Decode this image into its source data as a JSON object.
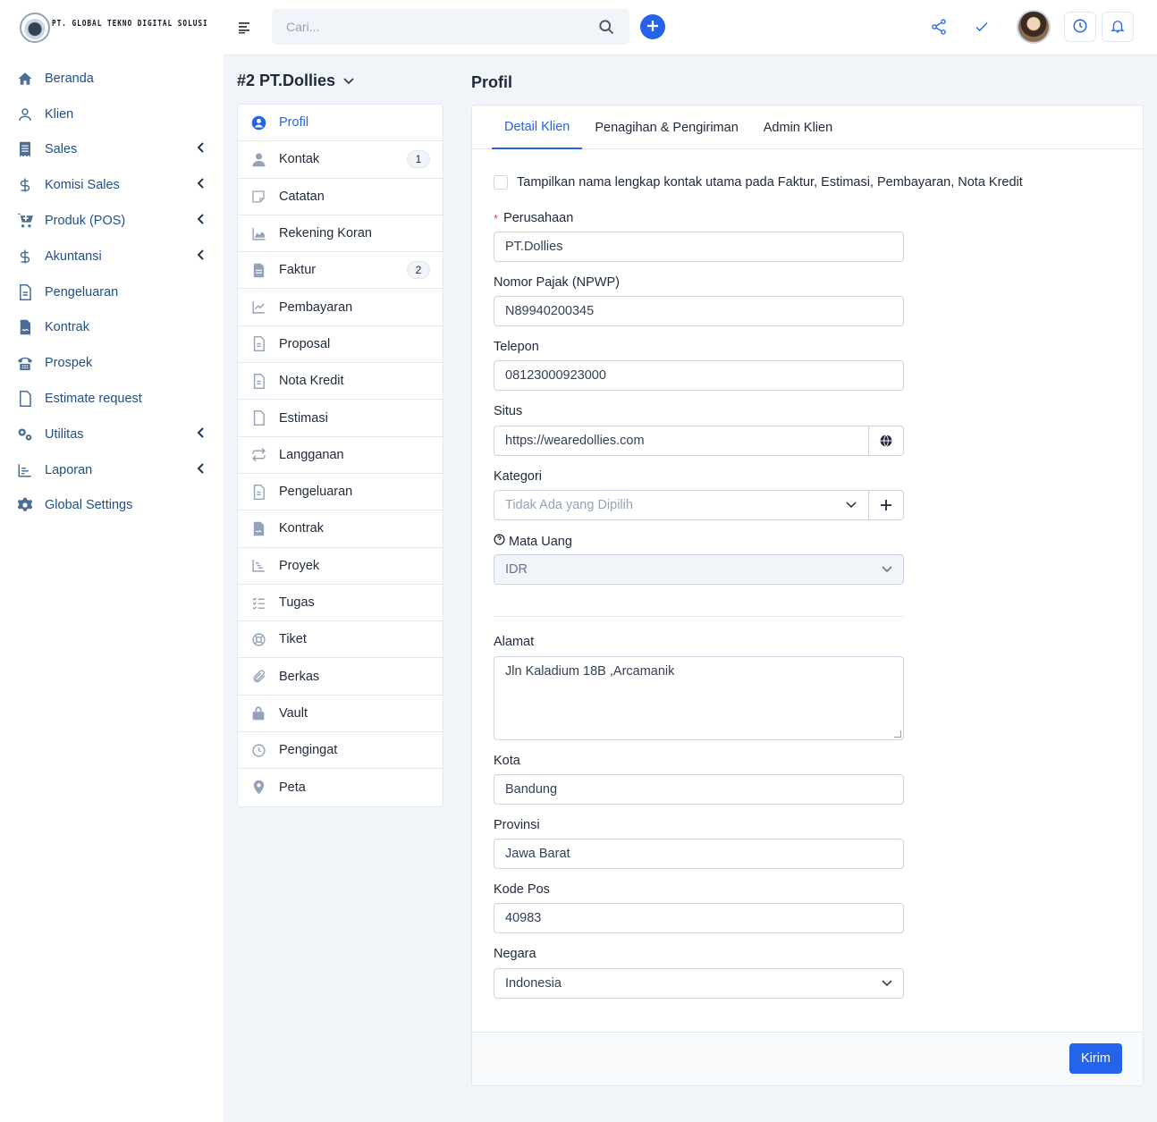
{
  "app": {
    "company_name": "PT. GLOBAL TEKNO DIGITAL SOLUSI"
  },
  "topbar": {
    "search_placeholder": "Cari...",
    "icons": [
      "menu-icon",
      "search-icon",
      "plus-icon",
      "share-icon",
      "check-icon",
      "clock-icon",
      "bell-icon"
    ]
  },
  "sidebar": {
    "items": [
      {
        "label": "Beranda",
        "icon": "home-icon",
        "submenu": false
      },
      {
        "label": "Klien",
        "icon": "user-icon",
        "submenu": false
      },
      {
        "label": "Sales",
        "icon": "receipt-icon",
        "submenu": true
      },
      {
        "label": "Komisi Sales",
        "icon": "dollar-icon",
        "submenu": true
      },
      {
        "label": "Produk (POS)",
        "icon": "cart-icon",
        "submenu": true
      },
      {
        "label": "Akuntansi",
        "icon": "dollar-icon",
        "submenu": true
      },
      {
        "label": "Pengeluaran",
        "icon": "file-text-icon",
        "submenu": false
      },
      {
        "label": "Kontrak",
        "icon": "contract-icon",
        "submenu": false
      },
      {
        "label": "Prospek",
        "icon": "phone-icon",
        "submenu": false
      },
      {
        "label": "Estimate request",
        "icon": "file-icon",
        "submenu": false
      },
      {
        "label": "Utilitas",
        "icon": "cogs-icon",
        "submenu": true
      },
      {
        "label": "Laporan",
        "icon": "chart-icon",
        "submenu": true
      },
      {
        "label": "Global Settings",
        "icon": "gear-icon",
        "submenu": false
      }
    ]
  },
  "client": {
    "title": "#2 PT.Dollies"
  },
  "client_tabs": [
    {
      "label": "Profil",
      "icon": "user-circle-icon",
      "badge": "",
      "active": true
    },
    {
      "label": "Kontak",
      "icon": "user-icon",
      "badge": "1",
      "active": false
    },
    {
      "label": "Catatan",
      "icon": "note-icon",
      "badge": "",
      "active": false
    },
    {
      "label": "Rekening Koran",
      "icon": "area-chart-icon",
      "badge": "",
      "active": false
    },
    {
      "label": "Faktur",
      "icon": "file-icon",
      "badge": "2",
      "active": false
    },
    {
      "label": "Pembayaran",
      "icon": "line-chart-icon",
      "badge": "",
      "active": false
    },
    {
      "label": "Proposal",
      "icon": "document-icon",
      "badge": "",
      "active": false
    },
    {
      "label": "Nota Kredit",
      "icon": "document-icon",
      "badge": "",
      "active": false
    },
    {
      "label": "Estimasi",
      "icon": "file-blank-icon",
      "badge": "",
      "active": false
    },
    {
      "label": "Langganan",
      "icon": "repeat-icon",
      "badge": "",
      "active": false
    },
    {
      "label": "Pengeluaran",
      "icon": "document-icon",
      "badge": "",
      "active": false
    },
    {
      "label": "Kontrak",
      "icon": "contract-icon",
      "badge": "",
      "active": false
    },
    {
      "label": "Proyek",
      "icon": "gantt-icon",
      "badge": "",
      "active": false
    },
    {
      "label": "Tugas",
      "icon": "checklist-icon",
      "badge": "",
      "active": false
    },
    {
      "label": "Tiket",
      "icon": "lifebuoy-icon",
      "badge": "",
      "active": false
    },
    {
      "label": "Berkas",
      "icon": "paperclip-icon",
      "badge": "",
      "active": false
    },
    {
      "label": "Vault",
      "icon": "lock-icon",
      "badge": "",
      "active": false
    },
    {
      "label": "Pengingat",
      "icon": "clock-icon",
      "badge": "",
      "active": false
    },
    {
      "label": "Peta",
      "icon": "map-pin-icon",
      "badge": "",
      "active": false
    }
  ],
  "profile": {
    "page_title": "Profil",
    "tabs": [
      "Detail Klien",
      "Penagihan & Pengiriman",
      "Admin Klien"
    ],
    "checkbox_label": "Tampilkan nama lengkap kontak utama pada Faktur, Estimasi, Pembayaran, Nota Kredit",
    "checkbox_checked": false,
    "fields": {
      "company_label": "Perusahaan",
      "company_required_mark": "*",
      "company_value": "PT.Dollies",
      "vat_label": "Nomor Pajak (NPWP)",
      "vat_value": "N89940200345",
      "phone_label": "Telepon",
      "phone_value": "08123000923000",
      "website_label": "Situs",
      "website_value": "https://wearedollies.com",
      "category_label": "Kategori",
      "category_placeholder": "Tidak Ada yang Dipilih",
      "currency_label": "Mata Uang",
      "currency_value": "IDR",
      "address_label": "Alamat",
      "address_value": "Jln Kaladium 18B ,Arcamanik",
      "city_label": "Kota",
      "city_value": "Bandung",
      "state_label": "Provinsi",
      "state_value": "Jawa Barat",
      "zip_label": "Kode Pos",
      "zip_value": "40983",
      "country_label": "Negara",
      "country_value": "Indonesia"
    },
    "submit_label": "Kirim"
  },
  "colors": {
    "primary": "#2563eb",
    "sidebar_text": "#1e4f8c",
    "background": "#f1f5f9"
  }
}
